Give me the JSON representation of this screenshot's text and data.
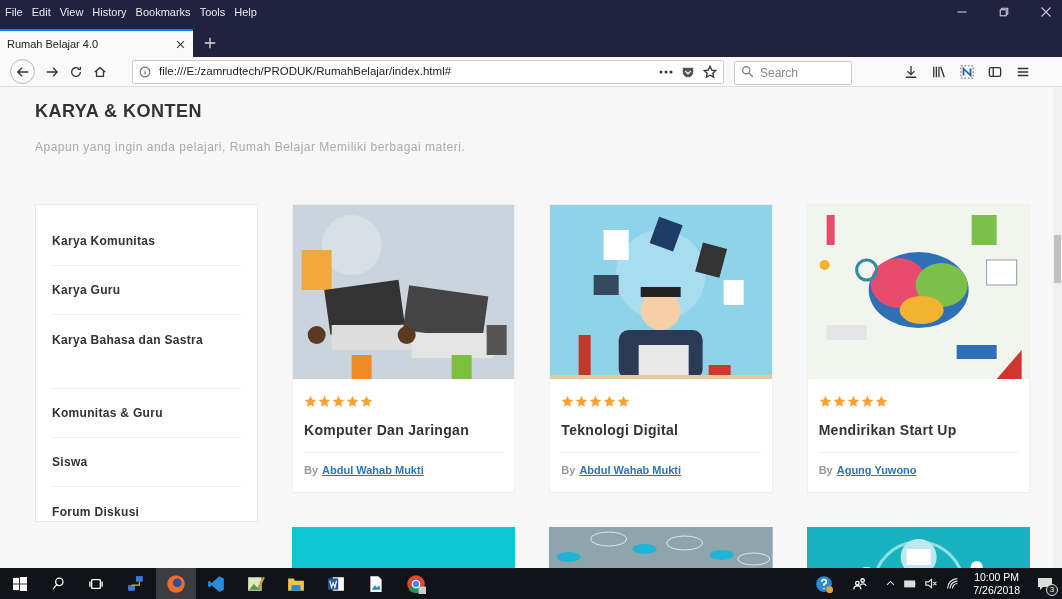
{
  "menu_bar": [
    "File",
    "Edit",
    "View",
    "History",
    "Bookmarks",
    "Tools",
    "Help"
  ],
  "tab": {
    "title": "Rumah Belajar 4.0",
    "selected": true
  },
  "toolbar": {
    "url": "file:///E:/zamrudtech/PRODUK/RumahBelajar/index.html#",
    "search": {
      "placeholder": "Search"
    }
  },
  "page": {
    "heading": "KARYA & KONTEN",
    "subtitle": "Apapun yang ingin anda pelajari, Rumah Belajar Memiliki berbagai materi.",
    "sidebar": {
      "groups": [
        [
          "Karya Komunitas",
          "Karya Guru",
          "Karya Bahasa dan Sastra"
        ],
        [
          "Komunitas & Guru",
          "Siswa",
          "Forum Diskusi"
        ]
      ]
    },
    "cards": [
      {
        "stars": 5,
        "title": "Komputer Dan Jaringan",
        "by": "By",
        "author": "Abdul Wahab Mukti"
      },
      {
        "stars": 5,
        "title": "Teknologi Digital",
        "by": "By",
        "author": "Abdul Wahab Mukti"
      },
      {
        "stars": 5,
        "title": "Mendirikan Start Up",
        "by": "By",
        "author": "Agung Yuwono"
      }
    ]
  },
  "taskbar": {
    "time": "10:00 PM",
    "date": "7/26/2018",
    "notifications": "3"
  }
}
